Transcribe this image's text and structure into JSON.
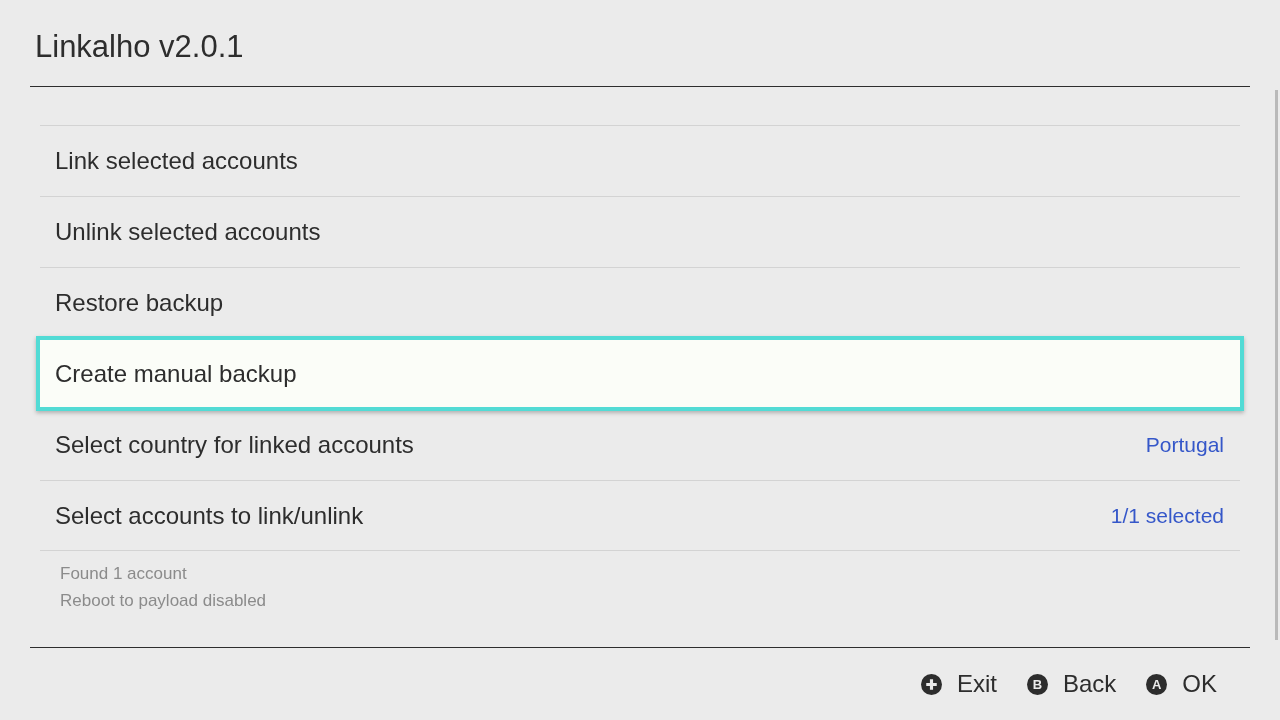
{
  "window": {
    "title": "Linkalho v2.0.1"
  },
  "menu": {
    "items": [
      {
        "label": "Link selected accounts",
        "selected": false
      },
      {
        "label": "Unlink selected accounts",
        "selected": false
      },
      {
        "label": "Restore backup",
        "selected": false
      },
      {
        "label": "Create manual backup",
        "selected": true
      },
      {
        "label": "Select country for linked accounts",
        "value": "Portugal",
        "selected": false
      },
      {
        "label": "Select accounts to link/unlink",
        "value": "1/1 selected",
        "selected": false
      }
    ]
  },
  "info": [
    "Found 1 account",
    "Reboot to payload disabled"
  ],
  "footer": {
    "actions": [
      {
        "kind": "plus",
        "label": "Exit"
      },
      {
        "kind": "letter",
        "key": "B",
        "label": "Back"
      },
      {
        "kind": "letter",
        "key": "A",
        "label": "OK"
      }
    ]
  }
}
